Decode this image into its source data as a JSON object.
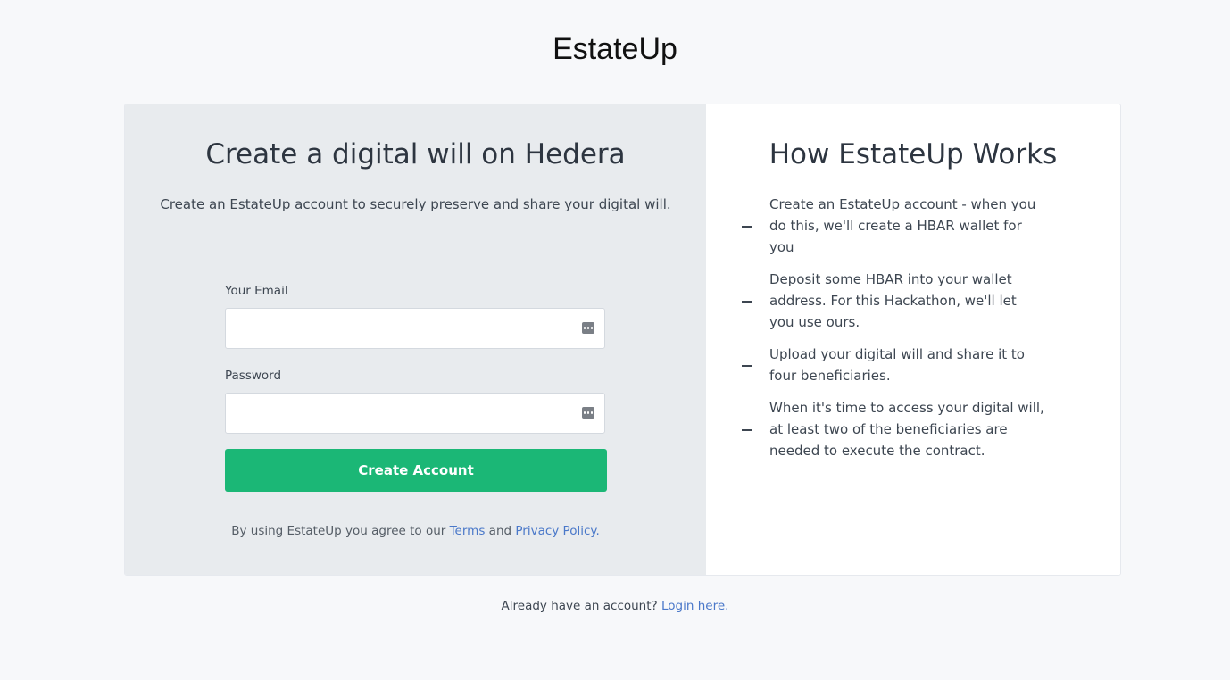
{
  "brand": {
    "logo_text": "EstateUp"
  },
  "signup": {
    "title": "Create a digital will on Hedera",
    "subtitle": "Create an EstateUp account to securely preserve and share your digital will.",
    "email_label": "Your Email",
    "email_value": "",
    "email_icon": "password-manager-dots-icon",
    "password_label": "Password",
    "password_value": "",
    "password_icon": "password-manager-dots-icon",
    "submit_label": "Create Account",
    "terms_prefix": "By using EstateUp you agree to our",
    "terms_link": "Terms",
    "terms_and": "and",
    "privacy_link": "Privacy Policy",
    "terms_suffix": "."
  },
  "how_it_works": {
    "title": "How EstateUp Works",
    "steps": [
      "Create an EstateUp account - when you do this, we'll create a HBAR wallet for you",
      "Deposit some HBAR into your wallet address. For this Hackathon, we'll let you use ours.",
      "Upload your digital will and share it to four beneficiaries.",
      "When it's time to access your digital will, at least two of the beneficiaries are needed to execute the contract."
    ]
  },
  "footer": {
    "prompt": "Already have an account?",
    "login_link": "Login here."
  },
  "colors": {
    "page_bg": "#f7f8fa",
    "left_panel_bg": "#e8ebee",
    "primary_button": "#1bb776",
    "link": "#4a78c9"
  }
}
